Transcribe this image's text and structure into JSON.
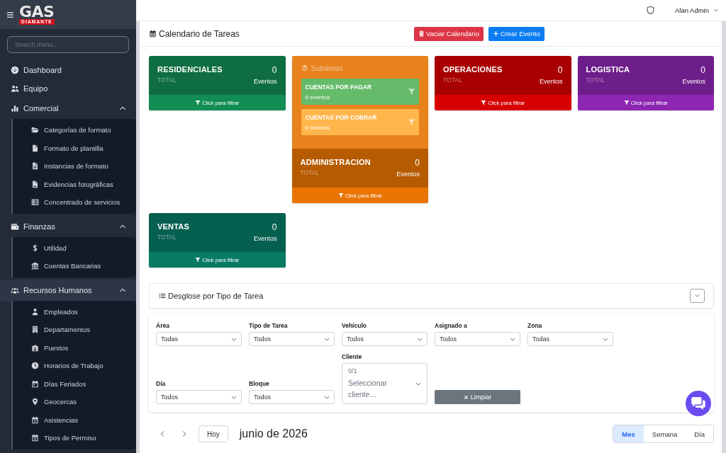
{
  "topbar": {
    "user": "Alan Admin"
  },
  "sidebar": {
    "logo": {
      "wordmark": "GAS",
      "band": "DIAMANTE"
    },
    "search": {
      "placeholder": "Search menu..."
    },
    "items": [
      {
        "label": "Dashboard",
        "selected": false
      },
      {
        "label": "Equipo",
        "selected": false
      },
      {
        "label": "Comercial",
        "selected": false,
        "expanded": true,
        "children": [
          {
            "label": "Categorías de formato"
          },
          {
            "label": "Formato de plantilla"
          },
          {
            "label": "Instancias de formato"
          },
          {
            "label": "Evidencias fotográficas"
          },
          {
            "label": "Concentrado de servicios"
          }
        ]
      },
      {
        "label": "Finanzas",
        "selected": false,
        "expanded": true,
        "children": [
          {
            "label": "Utilidad"
          },
          {
            "label": "Cuentas Bancarias"
          }
        ]
      },
      {
        "label": "Recursos Humanos",
        "selected": true,
        "expanded": true,
        "children": [
          {
            "label": "Empleados"
          },
          {
            "label": "Departamentos"
          },
          {
            "label": "Puestos"
          },
          {
            "label": "Horarios de Trabajo"
          },
          {
            "label": "Días Feriados"
          },
          {
            "label": "Geocercas"
          },
          {
            "label": "Asistencias"
          },
          {
            "label": "Tipos de Permiso"
          }
        ]
      }
    ]
  },
  "page": {
    "title": "Calendario de Tareas",
    "buttons": [
      {
        "label": "Vaciar Calendario",
        "kind": "danger"
      },
      {
        "label": "Crear Evento",
        "kind": "primary"
      }
    ]
  },
  "areas": [
    {
      "name": "RESIDENCIALES",
      "total_label": "TOTAL",
      "count": "0",
      "unit": "Eventos",
      "action": "Click para filtrar",
      "color": "#0e6e42"
    },
    {
      "subareas_title": "Subáreas",
      "subareas": [
        {
          "name": "CUENTAS POR PAGAR",
          "count": "0 eventos",
          "color": "#66bb6a"
        },
        {
          "name": "CUENTAS POR COBRAR",
          "count": "0 eventos",
          "color": "#ffb74d"
        }
      ],
      "name": "ADMINISTRACION",
      "total_label": "TOTAL",
      "count": "0",
      "unit": "Eventos",
      "action": "Click para filtrar",
      "color": "#b65b00"
    },
    {
      "name": "OPERACIONES",
      "total_label": "TOTAL",
      "count": "0",
      "unit": "Eventos",
      "action": "Click para filtrar",
      "color": "#a80000"
    },
    {
      "name": "LOGISTICA",
      "total_label": "TOTAL",
      "count": "0",
      "unit": "Eventos",
      "action": "Click para filtrar",
      "color": "#6e1e8a"
    },
    {
      "name": "VENTAS",
      "total_label": "TOTAL",
      "count": "0",
      "unit": "Eventos",
      "action": "Click para filtrar",
      "color": "#06604f"
    }
  ],
  "breakdown": {
    "title": "Desglose por Tipo de Tarea",
    "expanded": false
  },
  "filters": {
    "rows": [
      {
        "fields": [
          {
            "label": "Área",
            "kind": "select",
            "value": "Todas"
          },
          {
            "label": "Tipo de Tarea",
            "kind": "select",
            "value": "Todos"
          },
          {
            "label": "Vehículo",
            "kind": "select",
            "value": "Todos"
          },
          {
            "label": "Asignado a",
            "kind": "select",
            "value": "Todos"
          },
          {
            "label": "Zona",
            "kind": "select",
            "value": "Todas"
          }
        ]
      },
      {
        "fields": [
          {
            "label": "Día",
            "kind": "select",
            "value": "Todos"
          },
          {
            "label": "Bloque",
            "kind": "select",
            "value": "Todos"
          },
          {
            "label": "Cliente",
            "kind": "multiselect",
            "counter": "0/1",
            "placeholder": "Seleccionar cliente..."
          }
        ]
      }
    ],
    "clear_button": "Limpiar"
  },
  "calendar": {
    "today_button": "Hoy",
    "title": "junio de 2026",
    "views": [
      {
        "label": "Mes",
        "selected": true
      },
      {
        "label": "Semana",
        "selected": false
      },
      {
        "label": "Día",
        "selected": false
      }
    ]
  }
}
